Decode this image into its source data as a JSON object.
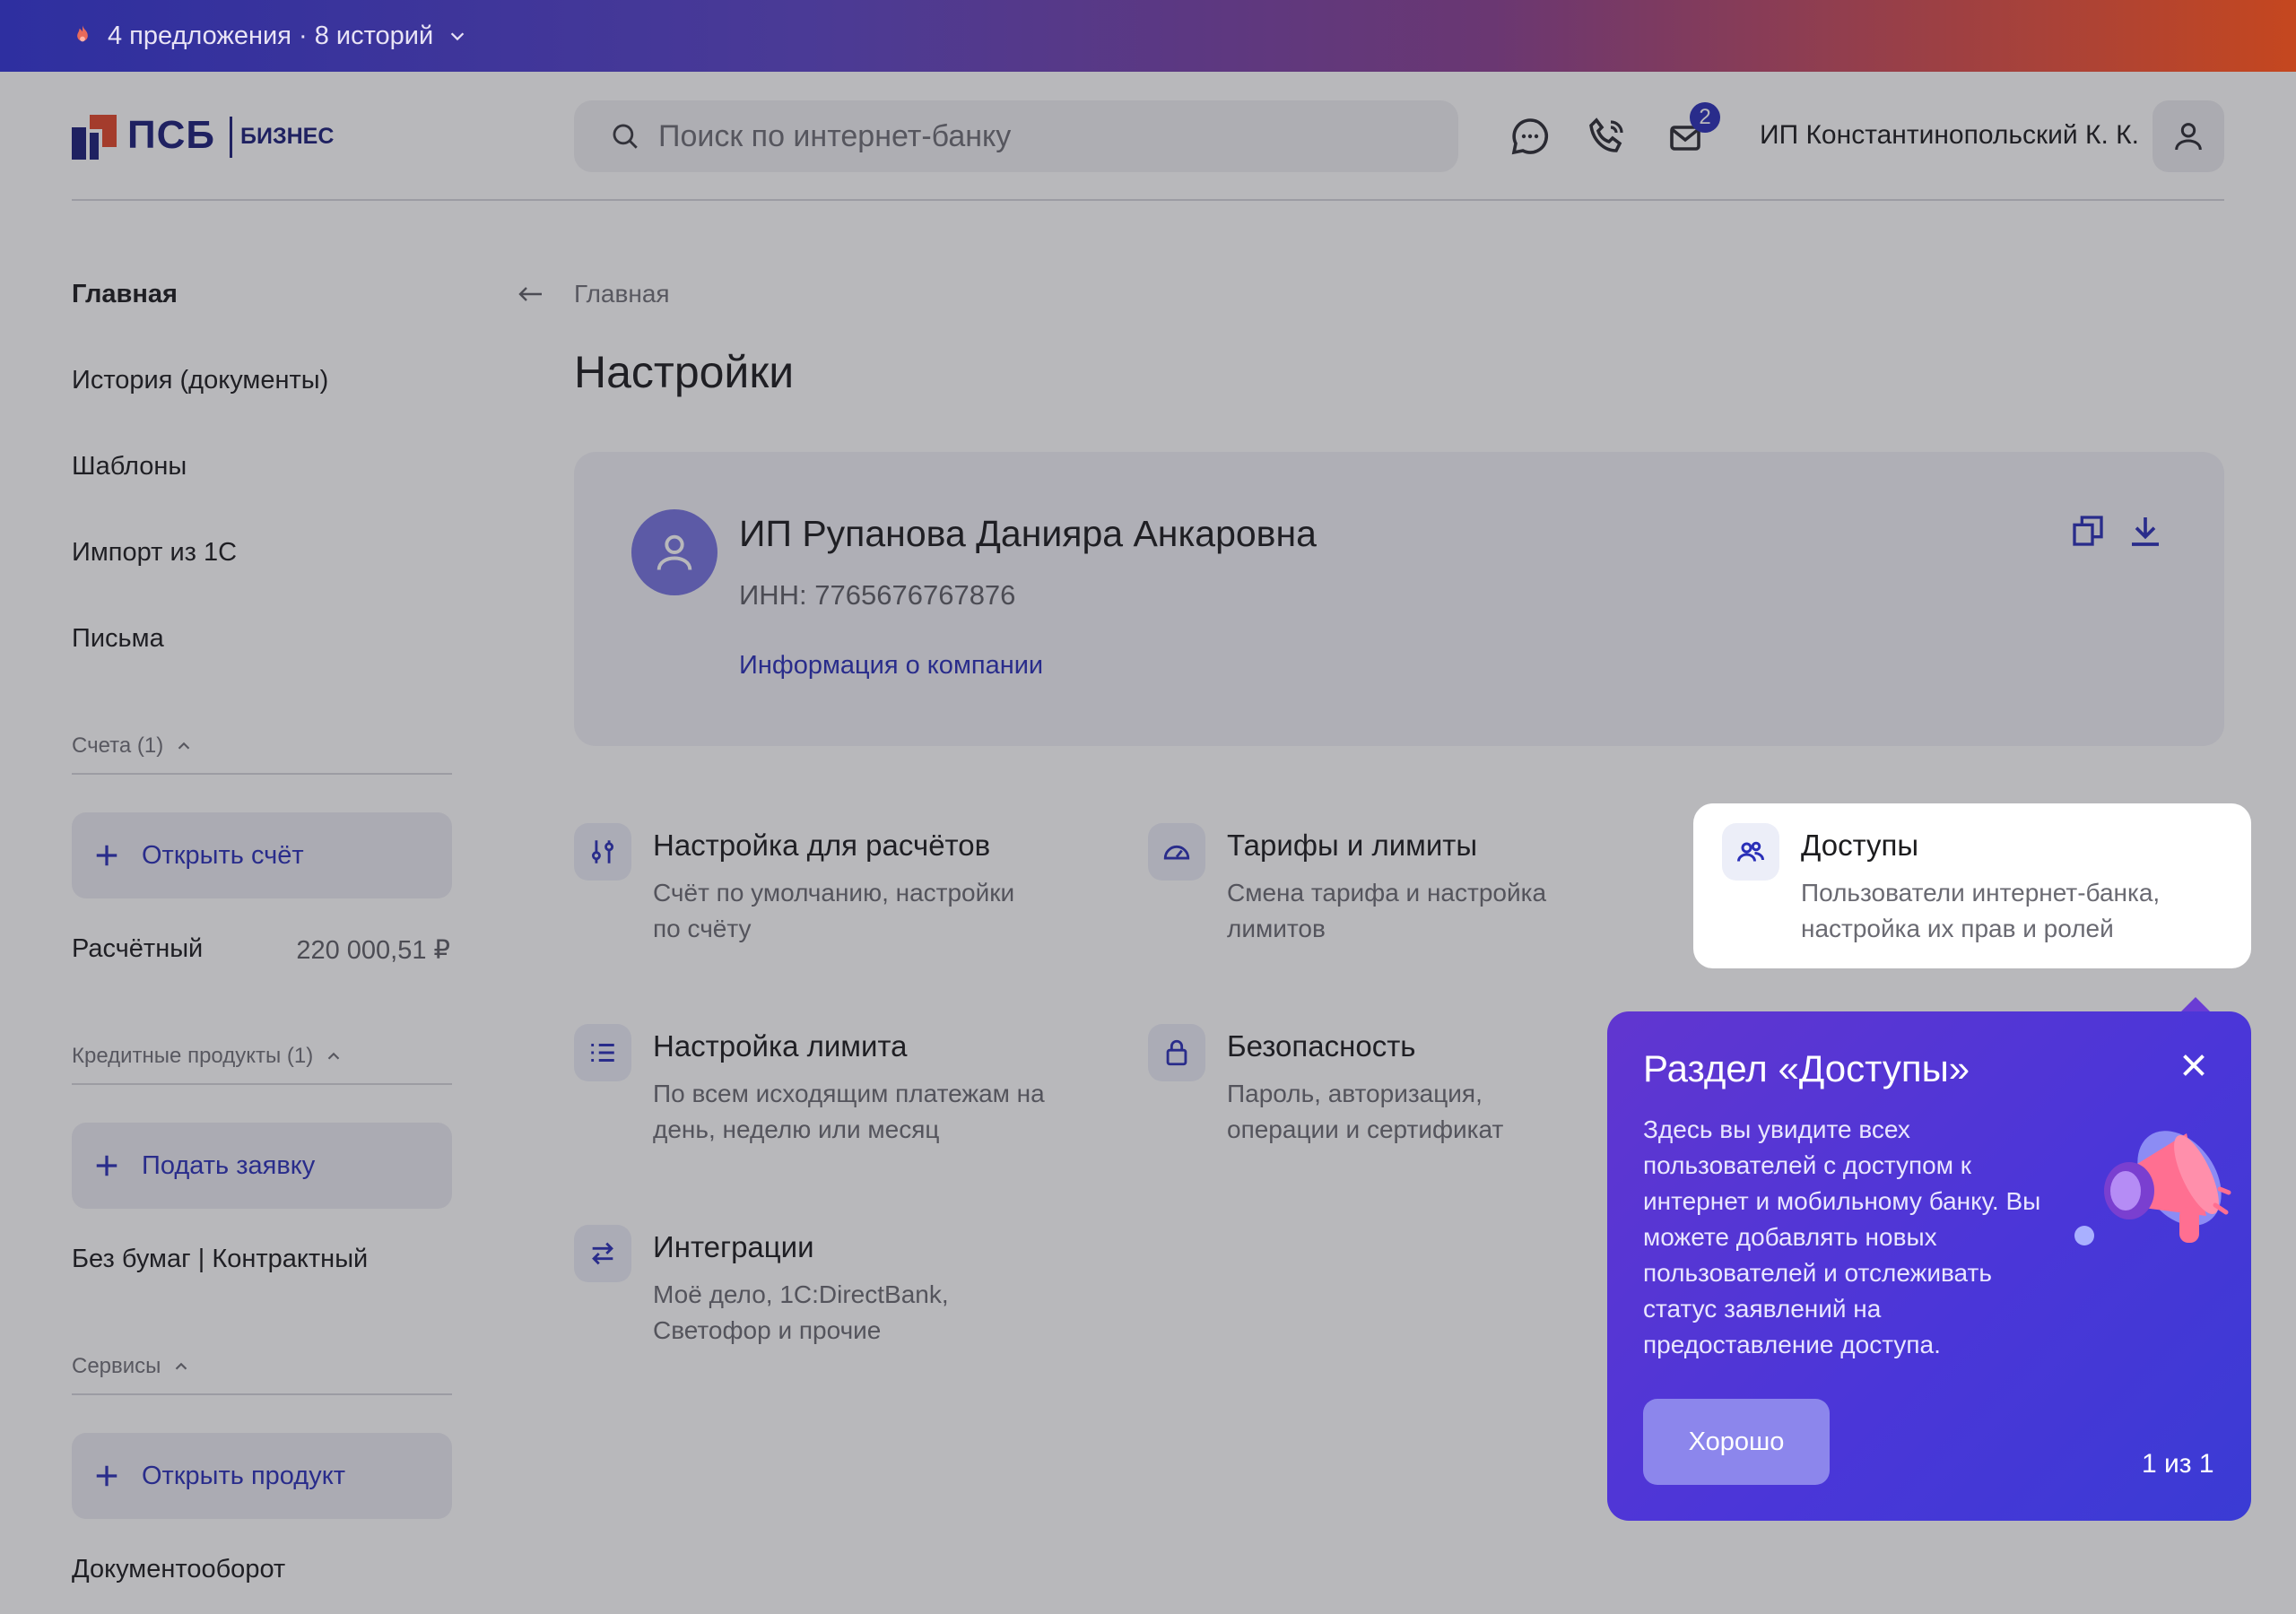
{
  "promo_bar": {
    "text": "4 предложения · 8 историй"
  },
  "header": {
    "logo_text": "ПСБ",
    "logo_sub": "БИЗНЕС",
    "search_placeholder": "Поиск по интернет-банку",
    "mail_badge": "2",
    "user_name": "ИП Константинопольский К. К.",
    "icons": [
      "chat-icon",
      "phone-icon",
      "mail-icon",
      "user-icon"
    ]
  },
  "sidebar": {
    "items": [
      "Главная",
      "История (документы)",
      "Шаблоны",
      "Импорт из 1С",
      "Письма"
    ],
    "accounts": {
      "section_label": "Счета (1)",
      "button_label": "Открыть счёт",
      "account_name": "Расчётный",
      "account_balance": "220 000,51 ₽"
    },
    "credits": {
      "section_label": "Кредитные продукты (1)",
      "button_label": "Подать заявку",
      "product": "Без бумаг | Контрактный"
    },
    "services": {
      "section_label": "Сервисы",
      "button_label": "Открыть продукт",
      "item": "Документооборот"
    }
  },
  "main": {
    "breadcrumb": "Главная",
    "title": "Настройки",
    "company": {
      "name": "ИП Рупанова Данияра Анкаровна",
      "inn": "ИНН: 7765676767876",
      "link": "Информация о компании"
    },
    "tiles": [
      {
        "icon": "sliders-icon",
        "title": "Настройка для расчётов",
        "desc": "Счёт по умолчанию, настройки по счёту"
      },
      {
        "icon": "speedometer-icon",
        "title": "Тарифы и лимиты",
        "desc": "Смена тарифа и настройка лимитов"
      },
      {
        "icon": "users-icon",
        "title": "Доступы",
        "desc": "Пользователи интернет-банка, настройка их прав и ролей"
      },
      {
        "icon": "list-icon",
        "title": "Настройка лимита",
        "desc": "По всем исходящим платежам на день, неделю или месяц"
      },
      {
        "icon": "lock-icon",
        "title": "Безопасность",
        "desc": "Пароль, авторизация, операции и сертификат"
      },
      {
        "icon": "swap-icon",
        "title": "Интеграции",
        "desc": "Моё дело, 1С:DirectBank, Светофор и прочие"
      }
    ]
  },
  "tooltip": {
    "title": "Раздел «Доступы»",
    "text": "Здесь вы увидите всех пользователей с доступом к интернет и мобильному банку. Вы можете добавлять новых пользователей и отслеживать статус заявлений на предоставление доступа.",
    "button": "Хорошо",
    "counter": "1 из 1"
  },
  "colors": {
    "accent": "#2a2fb8",
    "tooltip_bg": "#4b36d8",
    "brand_red": "#e2462a"
  }
}
